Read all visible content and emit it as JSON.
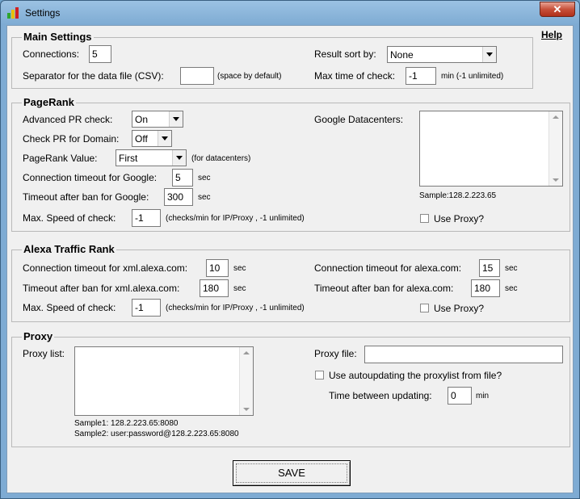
{
  "window": {
    "title": "Settings",
    "close_glyph": "✕",
    "icon": "app-bars-icon",
    "icon_colors": [
      "#2fa52f",
      "#e8c000",
      "#d02020"
    ]
  },
  "help_label": "Help",
  "main_settings": {
    "title": "Main Settings",
    "connections_label": "Connections:",
    "connections_value": "5",
    "separator_label": "Separator for the data file (CSV):",
    "separator_value": "",
    "separator_hint": "(space by default)",
    "sort_label": "Result sort by:",
    "sort_value": "None",
    "max_time_label": "Max time of check:",
    "max_time_value": "-1",
    "max_time_hint": "min (-1 unlimited)"
  },
  "pagerank": {
    "title": "PageRank",
    "advanced_label": "Advanced PR check:",
    "advanced_value": "On",
    "domain_label": "Check PR for Domain:",
    "domain_value": "Off",
    "value_label": "PageRank Value:",
    "value_value": "First",
    "value_hint": "(for datacenters)",
    "conn_timeout_label": "Connection timeout for Google:",
    "conn_timeout_value": "5",
    "conn_timeout_unit": "sec",
    "ban_timeout_label": "Timeout after ban for Google:",
    "ban_timeout_value": "300",
    "ban_timeout_unit": "sec",
    "max_speed_label": "Max. Speed of check:",
    "max_speed_value": "-1",
    "max_speed_hint": "(checks/min for IP/Proxy , -1 unlimited)",
    "datacenters_label": "Google Datacenters:",
    "datacenters_sample": "Sample:128.2.223.65",
    "use_proxy_label": "Use Proxy?"
  },
  "alexa": {
    "title": "Alexa Traffic Rank",
    "xml_conn_label": "Connection timeout for xml.alexa.com:",
    "xml_conn_value": "10",
    "xml_conn_unit": "sec",
    "xml_ban_label": "Timeout after ban for xml.alexa.com:",
    "xml_ban_value": "180",
    "xml_ban_unit": "sec",
    "max_speed_label": "Max. Speed of check:",
    "max_speed_value": "-1",
    "max_speed_hint": "(checks/min for IP/Proxy , -1 unlimited)",
    "conn_label": "Connection timeout for alexa.com:",
    "conn_value": "15",
    "conn_unit": "sec",
    "ban_label": "Timeout after ban for alexa.com:",
    "ban_value": "180",
    "ban_unit": "sec",
    "use_proxy_label": "Use Proxy?"
  },
  "proxy": {
    "title": "Proxy",
    "list_label": "Proxy list:",
    "sample1": "Sample1: 128.2.223.65:8080",
    "sample2": "Sample2: user:password@128.2.223.65:8080",
    "file_label": "Proxy file:",
    "file_value": "",
    "autoupdate_label": "Use autoupdating the proxylist from file?",
    "interval_label": "Time between updating:",
    "interval_value": "0",
    "interval_unit": "min"
  },
  "save_label": "SAVE"
}
